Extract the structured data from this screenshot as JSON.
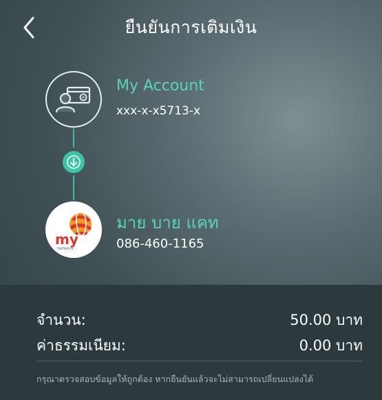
{
  "header": {
    "title": "ยืนยันการเติมเงิน",
    "back_icon": "chevron-left-icon"
  },
  "source": {
    "icon": "account-card-icon",
    "name": "My Account",
    "number": "xxx-x-x5713-x"
  },
  "transfer_icon": "arrow-down-icon",
  "destination": {
    "logo": "my-network-logo",
    "logo_text": "my",
    "logo_subtext": "network",
    "name": "มาย บาย แคท",
    "number": "086-460-1165"
  },
  "summary": {
    "amount_label": "จำนวน:",
    "amount_value": "50.00 บาท",
    "fee_label": "ค่าธรรมเนียม:",
    "fee_value": "0.00 บาท",
    "note": "กรุณาตรวจสอบข้อมูลให้ถูกต้อง หากยืนยันแล้วจะไม่สามารถเปลี่ยนแปลงได้"
  },
  "colors": {
    "accent": "#3cc4a9",
    "accent_text": "#58d4b7",
    "summary_bg": "#2c3a3e",
    "logo_red": "#e0342c",
    "logo_orange": "#f29a1f"
  }
}
